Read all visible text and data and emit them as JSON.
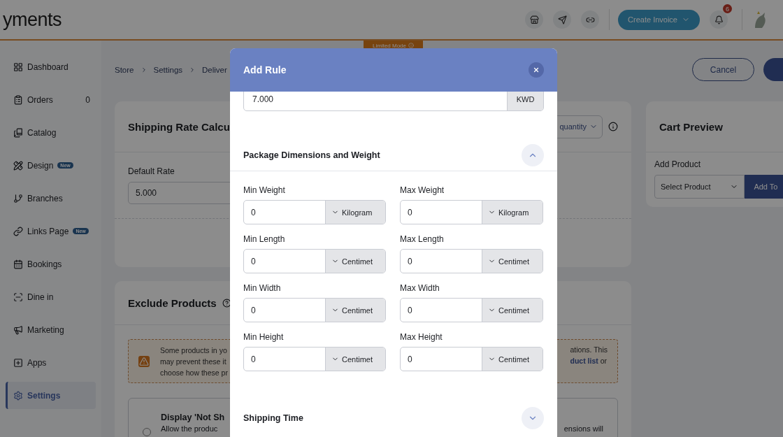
{
  "header": {
    "logo_text": "yments",
    "create_invoice": "Create Invoice",
    "notification_count": "6",
    "limited_mode": "Limited Mode"
  },
  "sidebar": {
    "items": [
      {
        "label": "Dashboard",
        "selected": false
      },
      {
        "label": "Orders",
        "count": "0",
        "selected": false
      },
      {
        "label": "Catalog",
        "selected": false
      },
      {
        "label": "Design",
        "badge": "New",
        "selected": false
      },
      {
        "label": "Branches",
        "selected": false
      },
      {
        "label": "Links Page",
        "badge": "New",
        "selected": false
      },
      {
        "label": "Bookings",
        "selected": false
      },
      {
        "label": "Dine in",
        "selected": false
      },
      {
        "label": "Marketing",
        "selected": false
      },
      {
        "label": "Apps",
        "selected": false
      },
      {
        "label": "Settings",
        "selected": true
      }
    ]
  },
  "breadcrumb": [
    "Store",
    "Settings",
    "Deliver"
  ],
  "actions": {
    "cancel": "Cancel"
  },
  "shipping_card": {
    "title": "Shipping Rate Calcu",
    "select_value": "quantity",
    "default_rate_label": "Default Rate",
    "default_rate_value": "5.000"
  },
  "exclude_card": {
    "title": "Exclude Products",
    "warning_left": [
      "Some products in yo",
      "may prevent these it",
      "choose how these pr"
    ],
    "warning_right": [
      "ations. This",
      "**duct list** or"
    ],
    "option_title": "Display 'Not Sh",
    "option_text": "Allow the produc",
    "option_text_right": "ensions will",
    "option_selected": false
  },
  "cart_preview": {
    "title": "Cart Preview",
    "add_product_label": "Add Product",
    "select_placeholder": "Select Product",
    "add_button": "Add To"
  },
  "modal": {
    "title": "Add Rule",
    "price_value": "7.000",
    "currency": "KWD",
    "sections": [
      {
        "title": "Package Dimensions and Weight",
        "expanded": true
      },
      {
        "title": "Shipping Time",
        "expanded": false
      }
    ],
    "fields": [
      {
        "label": "Min Weight",
        "value": "0",
        "unit": "Kilogram"
      },
      {
        "label": "Max Weight",
        "value": "0",
        "unit": "Kilogram"
      },
      {
        "label": "Min Length",
        "value": "0",
        "unit": "Centimet"
      },
      {
        "label": "Max Length",
        "value": "0",
        "unit": "Centimet"
      },
      {
        "label": "Min Width",
        "value": "0",
        "unit": "Centimet"
      },
      {
        "label": "Max Width",
        "value": "0",
        "unit": "Centimet"
      },
      {
        "label": "Min Height",
        "value": "0",
        "unit": "Centimet"
      },
      {
        "label": "Max Height",
        "value": "0",
        "unit": "Centimet"
      }
    ]
  }
}
